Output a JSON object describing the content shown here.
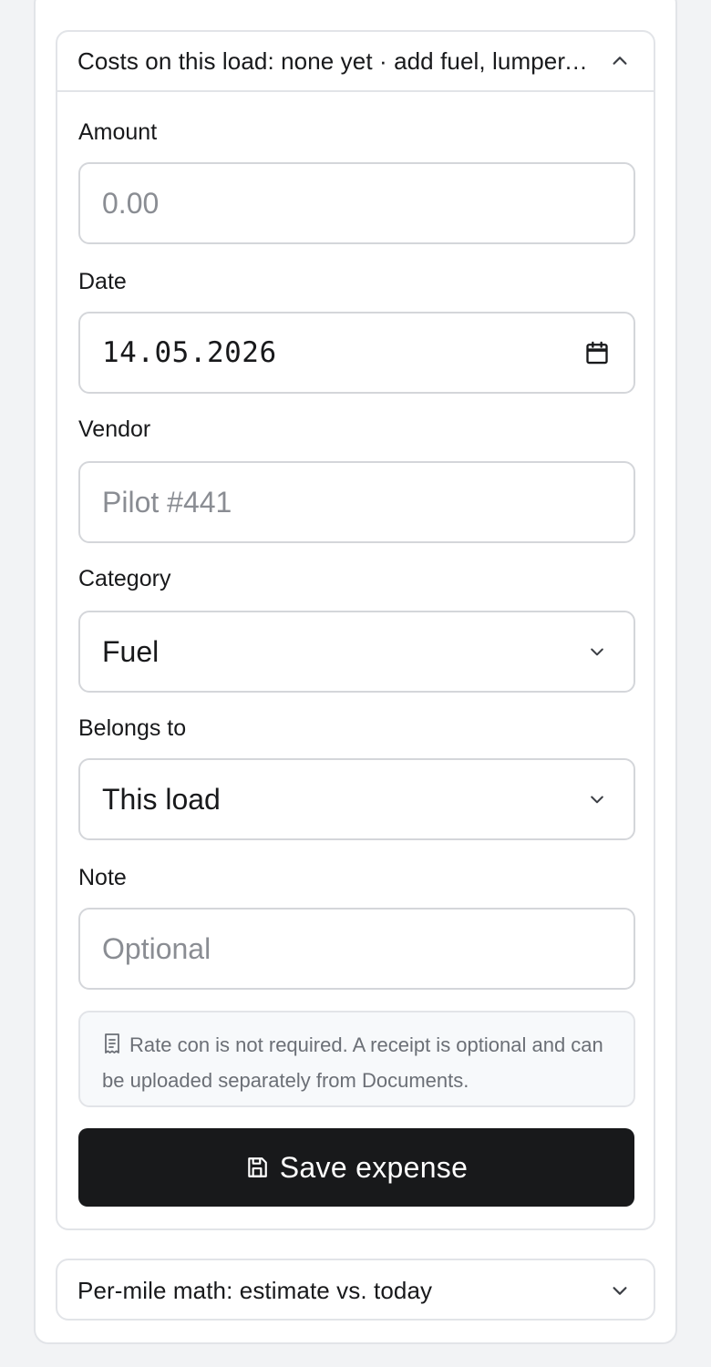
{
  "costs_section": {
    "title": "Costs on this load: none yet · add fuel, lumper, tolls",
    "toggle_icon": "chevron-up-icon"
  },
  "form": {
    "amount": {
      "label": "Amount",
      "placeholder": "0.00",
      "value": ""
    },
    "date": {
      "label": "Date",
      "value": "14.05.2026",
      "icon": "calendar-icon"
    },
    "vendor": {
      "label": "Vendor",
      "placeholder": "Pilot #441",
      "value": ""
    },
    "category": {
      "label": "Category",
      "selected": "Fuel",
      "icon": "chevron-down-icon"
    },
    "belongs_to": {
      "label": "Belongs to",
      "selected": "This load",
      "icon": "chevron-down-icon"
    },
    "note": {
      "label": "Note",
      "placeholder": "Optional",
      "value": ""
    }
  },
  "info": {
    "icon": "document-icon",
    "text": "Rate con is not required. A receipt is optional and can be uploaded separately from Documents."
  },
  "save_button": {
    "label": "Save expense",
    "icon": "save-icon"
  },
  "per_mile_section": {
    "title": "Per-mile math: estimate vs. today",
    "toggle_icon": "chevron-down-icon"
  },
  "colors": {
    "background": "#f2f3f5",
    "card": "#ffffff",
    "border": "#e2e4e8",
    "primary_button": "#18191b",
    "muted_text": "#6b6f76"
  }
}
